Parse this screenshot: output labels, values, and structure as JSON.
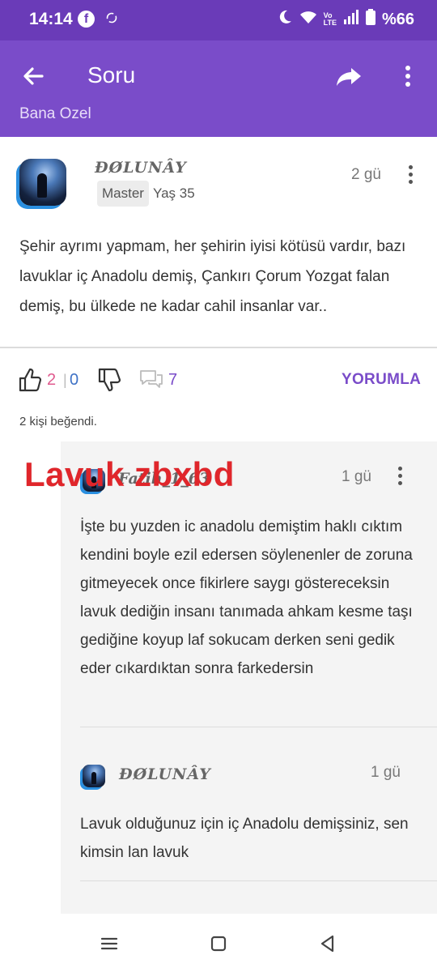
{
  "status_bar": {
    "time": "14:14",
    "battery": "%66",
    "icons": [
      "facebook-icon",
      "sync-icon",
      "moon-icon",
      "wifi-icon",
      "volte-icon",
      "signal-icon",
      "battery-icon"
    ]
  },
  "app_bar": {
    "title": "Soru",
    "icons": [
      "back-arrow-icon",
      "share-icon",
      "more-vert-icon"
    ]
  },
  "subheader": {
    "text": "Bana Özel"
  },
  "post": {
    "author": "ĐØLUNÂY",
    "badge": "Master",
    "age": "Yaş 35",
    "time": "2 gü",
    "body": "Şehir ayrımı yapmam, her şehirin iyisi kötüsü vardır, bazı lavuklar iç Anadolu demiş, Çankırı Çorum Yozgat falan demiş, bu ülkede ne kadar cahil insanlar var.."
  },
  "actions": {
    "like_count": "2",
    "separator": "|",
    "dislike_count": "0",
    "comment_count": "7",
    "comment_button": "YORUMLA",
    "likes_note": "2 kişi beğendi."
  },
  "overlay": {
    "text": "Lavuk zbxbd"
  },
  "replies": [
    {
      "author": "Fatih_1_63",
      "time": "1 gü",
      "body": "İşte bu yuzden ic anadolu demiştim haklı cıktım kendini boyle ezil edersen söylenenler de zoruna gitmeyecek once fikirlere saygı göstereceksin lavuk dediğin insanı tanımada ahkam kesme taşı gediğine koyup laf sokucam derken seni gedik eder cıkardıktan sonra farkedersin"
    },
    {
      "author": "ĐØLUNÂY",
      "time": "1 gü",
      "body": "Lavuk olduğunuz için iç Anadolu demişsiniz, sen kimsin lan lavuk"
    }
  ],
  "colors": {
    "status_bar": "#6a3bb8",
    "app_bar": "#7a4cc9",
    "like": "#e05a8e",
    "dislike": "#3f72c6",
    "accent": "#7a4cc9",
    "overlay_red": "#e0262b"
  }
}
